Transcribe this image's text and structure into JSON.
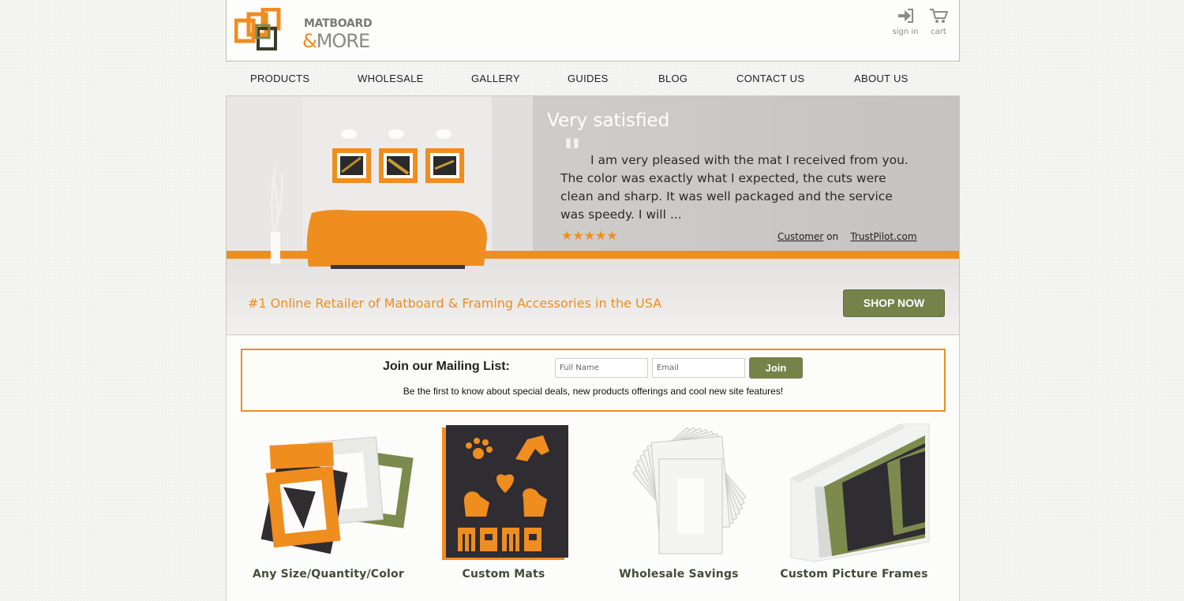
{
  "brand": {
    "name_line1": "MATBOARD",
    "name_line2_amp": "&",
    "name_line2": "MORE"
  },
  "header": {
    "signin_label": "sign in",
    "cart_label": "cart"
  },
  "nav": [
    "PRODUCTS",
    "WHOLESALE",
    "GALLERY",
    "GUIDES",
    "BLOG",
    "CONTACT US",
    "ABOUT US"
  ],
  "hero": {
    "testimonial_title": "Very satisfied",
    "quote_mark": "\"",
    "testimonial_text": "I am very pleased with the mat I received from you. The color was exactly what I expected, the cuts were clean and sharp. It was well packaged and the service was speedy. I will ...",
    "stars": "★★★★★",
    "rating": 5,
    "reviewer": "Customer",
    "on": "on",
    "source": "TrustPilot.com",
    "tagline": "#1 Online Retailer of Matboard & Framing Accessories in the USA",
    "shop_now": "SHOP NOW"
  },
  "mailing": {
    "title": "Join our Mailing List:",
    "name_placeholder": "Full Name",
    "email_placeholder": "Email",
    "join_label": "Join",
    "subtitle": "Be the first to know about special deals, new products offerings and cool new site features!"
  },
  "products": [
    {
      "label": "Any Size/Quantity/Color"
    },
    {
      "label": "Custom Mats"
    },
    {
      "label": "Wholesale Savings"
    },
    {
      "label": "Custom Picture Frames"
    }
  ],
  "colors": {
    "accent_orange": "#ef8d1f",
    "olive": "#77814a",
    "dark_frame": "#2f2c32",
    "sage": "#7d8a4e"
  }
}
